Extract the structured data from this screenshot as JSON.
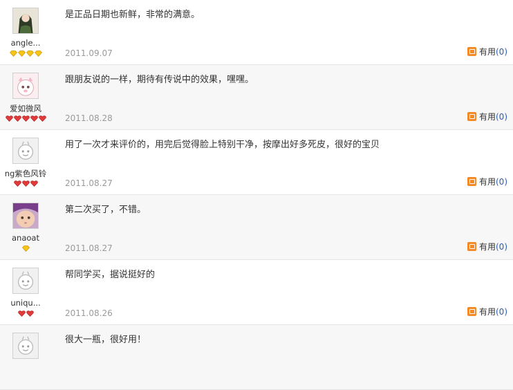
{
  "colors": {
    "accent": "#f28a2a",
    "count_link": "#2a5db0",
    "date": "#9a9a9a",
    "row_alt_bg": "#f7f7f7"
  },
  "useful_label": "有用",
  "reviews": [
    {
      "username": "angle...",
      "avatar": "anime-girl-avatar",
      "badge_type": "gold-diamond",
      "badge_count": 4,
      "content": "是正品日期也新鲜，非常的满意。",
      "date": "2011.09.07",
      "useful_count": "(0)"
    },
    {
      "username": "爱如微风",
      "avatar": "pink-pig-avatar",
      "badge_type": "red-heart",
      "badge_count": 5,
      "content": "跟朋友说的一样，期待有传说中的效果，嘿嘿。",
      "date": "2011.08.28",
      "useful_count": "(0)"
    },
    {
      "username": "ng紫色风铃",
      "avatar": "default-avatar",
      "badge_type": "red-heart",
      "badge_count": 3,
      "content": "用了一次才来评价的，用完后觉得脸上特别干净，按摩出好多死皮，很好的宝贝",
      "date": "2011.08.27",
      "useful_count": "(0)"
    },
    {
      "username": "anaoat",
      "avatar": "baby-photo-avatar",
      "badge_type": "gold-diamond",
      "badge_count": 1,
      "content": "第二次买了，不错。",
      "date": "2011.08.27",
      "useful_count": "(0)"
    },
    {
      "username": "uniqu...",
      "avatar": "default-avatar",
      "badge_type": "red-heart",
      "badge_count": 2,
      "content": "帮同学买，据说挺好的",
      "date": "2011.08.26",
      "useful_count": "(0)"
    },
    {
      "username": "",
      "avatar": "default-avatar",
      "badge_type": "",
      "badge_count": 0,
      "content": "很大一瓶，很好用！",
      "date": "",
      "useful_count": ""
    }
  ]
}
